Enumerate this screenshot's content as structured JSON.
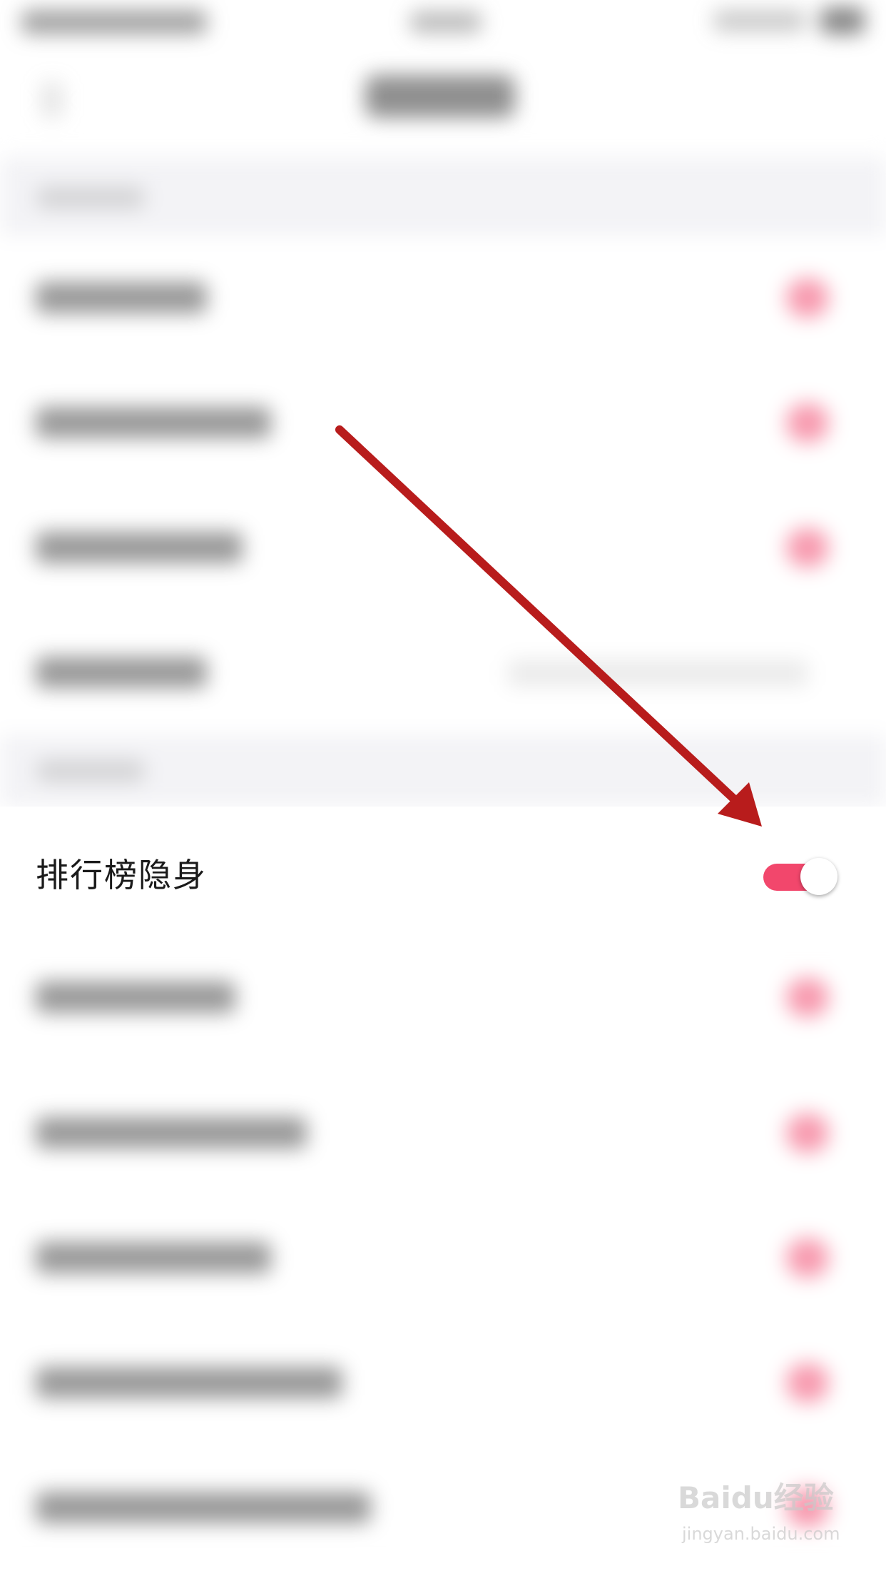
{
  "focus_setting": {
    "label": "排行榜隐身",
    "enabled": true
  },
  "colors": {
    "toggle_on": "#f2476c",
    "annotation_arrow": "#b81c1c",
    "section_background": "#f3f3f6"
  },
  "watermark": {
    "brand": "Baidu经验",
    "url": "jingyan.baidu.com"
  },
  "blurred_rows": {
    "group_one": [
      "toggle",
      "toggle",
      "toggle",
      "value"
    ],
    "group_two": [
      "toggle",
      "toggle",
      "toggle",
      "toggle",
      "toggle"
    ]
  }
}
